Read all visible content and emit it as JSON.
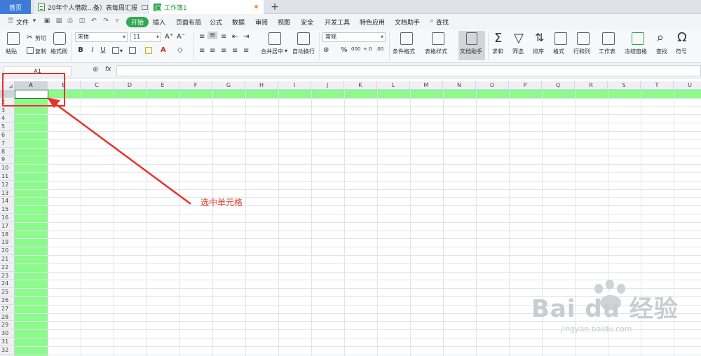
{
  "tabs": {
    "home": "首页",
    "doc": "20年个人借款...备）表每周汇报",
    "sheet": "工作簿1",
    "add": "+"
  },
  "menu": {
    "file": "文件",
    "items": [
      "开始",
      "插入",
      "页面布局",
      "公式",
      "数据",
      "审阅",
      "视图",
      "安全",
      "开发工具",
      "特色应用",
      "文档助手",
      "查找"
    ],
    "active": "开始"
  },
  "ribbon": {
    "paste": "粘贴",
    "cut": "剪切",
    "copy": "复制",
    "format_painter": "格式刷",
    "font_name": "宋体",
    "font_size": "11",
    "bold": "B",
    "italic": "I",
    "underline": "U",
    "merge_center": "合并居中",
    "wrap_text": "自动换行",
    "number_format": "常规",
    "percent": "%",
    "thousands": "000",
    "dec_inc": "+.0",
    "dec_dec": ".00",
    "conditional_format": "条件格式",
    "table_style": "表格样式",
    "doc_helper": "文档助手",
    "sum": "求和",
    "filter": "筛选",
    "sort": "排序",
    "format": "格式",
    "row_col": "行和列",
    "worksheet": "工作表",
    "freeze": "冻结窗格",
    "find": "查找",
    "symbol": "符号"
  },
  "formula_bar": {
    "name_box": "A1",
    "fx": "fx",
    "value": ""
  },
  "columns": [
    "A",
    "B",
    "C",
    "D",
    "E",
    "F",
    "G",
    "H",
    "I",
    "J",
    "K",
    "L",
    "M",
    "N",
    "O",
    "P",
    "Q",
    "R",
    "S",
    "T",
    "U"
  ],
  "selected_column": "A",
  "active_cell": "A1",
  "rows_visible": 32,
  "colors": {
    "selection_fill": "#8cfa8c",
    "accent_green": "#2fa84f",
    "home_tab": "#3e7bd8",
    "annotation_red": "#e8332a"
  },
  "annotation": {
    "label": "选中单元格"
  },
  "watermark": {
    "brand": "Bai du 经验",
    "url": "jingyan.baidu.com"
  }
}
